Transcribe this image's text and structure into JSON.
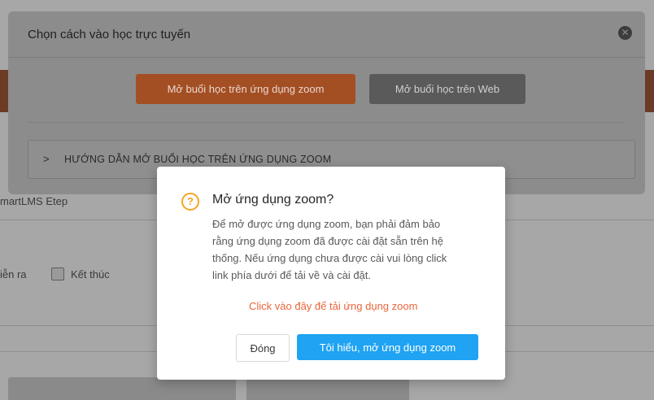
{
  "background": {
    "left_label": "martLMS Etep",
    "filter_label_partial": "iễn ra",
    "filter_checkbox_label": "Kết thúc"
  },
  "online_dialog": {
    "title": "Chọn cách vào học trực tuyến",
    "zoom_button": "Mở buổi học trên ứng dụng zoom",
    "web_button": "Mở buổi học trên Web",
    "guide_chevron": ">",
    "guide_label": "HƯỚNG DẪN MỞ BUỔI HỌC TRÊN ỨNG DỤNG ZOOM"
  },
  "confirm_dialog": {
    "title": "Mở ứng dụng zoom?",
    "body": "Để mở được ứng dụng zoom, bạn phải đảm bảo rằng ứng dụng zoom đã được cài đặt sẵn trên hệ thống. Nếu ứng dụng chưa được cài vui lòng click link phía dưới để tải về và cài đặt.",
    "download_link": "Click vào đây để tải ứng dụng zoom",
    "close_button": "Đóng",
    "confirm_button": "Tôi hiểu, mở ứng dụng zoom"
  },
  "colors": {
    "accent_orange": "#e8663a",
    "primary_blue": "#1fa3f2",
    "warning_icon": "#f5a623"
  },
  "icons": {
    "close": "close-icon",
    "question": "question-circle-icon",
    "chevron": "chevron-right-icon"
  }
}
